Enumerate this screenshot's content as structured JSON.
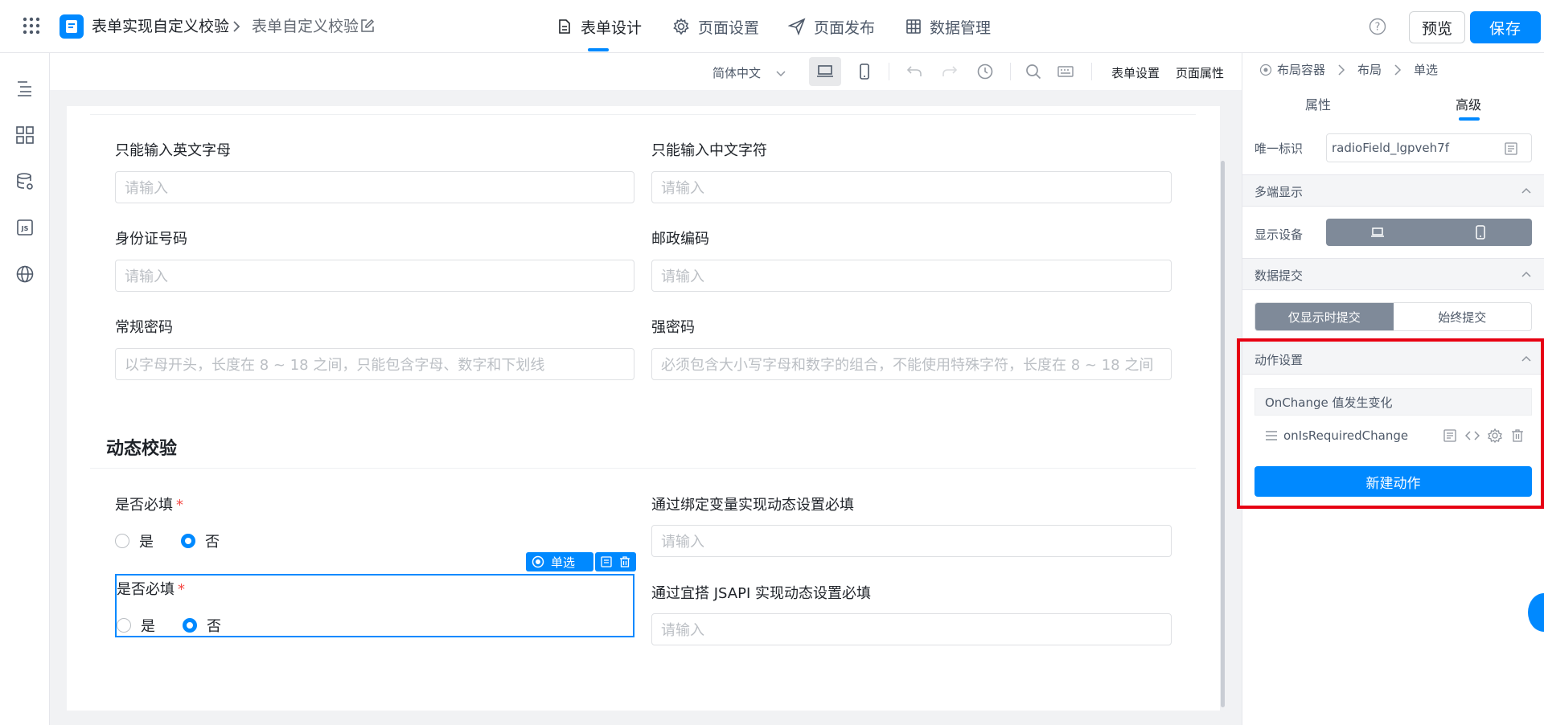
{
  "header": {
    "app_title": "表单实现自定义校验",
    "form_name": "表单自定义校验",
    "tabs": [
      {
        "label": "表单设计",
        "icon": "document-icon"
      },
      {
        "label": "页面设置",
        "icon": "gear-icon"
      },
      {
        "label": "页面发布",
        "icon": "send-icon"
      },
      {
        "label": "数据管理",
        "icon": "table-icon"
      }
    ],
    "preview_label": "预览",
    "save_label": "保存"
  },
  "sidebar": {
    "items": [
      {
        "icon": "outline-icon"
      },
      {
        "icon": "components-icon"
      },
      {
        "icon": "data-source-icon"
      },
      {
        "icon": "js-icon",
        "text": "JS"
      },
      {
        "icon": "globe-icon"
      }
    ]
  },
  "toolbar": {
    "language": "简体中文",
    "form_settings": "表单设置",
    "page_props": "页面属性"
  },
  "form": {
    "fields": [
      {
        "label": "只能输入英文字母",
        "placeholder": "请输入"
      },
      {
        "label": "只能输入中文字符",
        "placeholder": "请输入"
      },
      {
        "label": "身份证号码",
        "placeholder": "请输入"
      },
      {
        "label": "邮政编码",
        "placeholder": "请输入"
      },
      {
        "label": "常规密码",
        "placeholder": "以字母开头，长度在 8 ~ 18 之间，只能包含字母、数字和下划线"
      },
      {
        "label": "强密码",
        "placeholder": "必须包含大小写字母和数字的组合，不能使用特殊字符，长度在 8 ~ 18 之间"
      }
    ],
    "section_title": "动态校验",
    "required_label_1": "是否必填",
    "required_label_2": "是否必填",
    "required_mark": "*",
    "option_yes": "是",
    "option_no": "否",
    "selected_option": "否",
    "bind_label": "通过绑定变量实现动态设置必填",
    "bind_placeholder": "请输入",
    "jsapi_label": "通过宜搭 JSAPI 实现动态设置必填",
    "jsapi_placeholder": "请输入",
    "selected_tag": "单选"
  },
  "panel": {
    "breadcrumb": [
      "布局容器",
      "布局",
      "单选"
    ],
    "tab_props": "属性",
    "tab_advanced": "高级",
    "active_tab": "高级",
    "uid_label": "唯一标识",
    "uid_value": "radioField_lgpveh7f",
    "multi_display": "多端显示",
    "display_device": "显示设备",
    "data_submit": "数据提交",
    "submit_when_shown": "仅显示时提交",
    "submit_always": "始终提交",
    "action_settings": "动作设置",
    "event_name": "OnChange 值发生变化",
    "action_name": "onIsRequiredChange",
    "new_action": "新建动作"
  }
}
